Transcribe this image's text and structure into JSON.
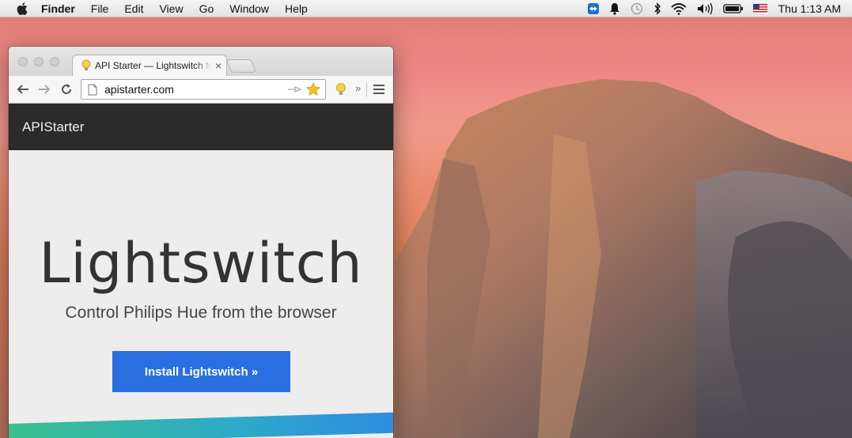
{
  "menubar": {
    "app_name": "Finder",
    "menus": [
      "File",
      "Edit",
      "View",
      "Go",
      "Window",
      "Help"
    ],
    "clock": "Thu 1:13 AM",
    "tray_icons": [
      "teamviewer-icon",
      "notification-bell-icon",
      "time-machine-icon",
      "bluetooth-icon",
      "wifi-icon",
      "volume-icon",
      "battery-icon",
      "us-flag-input-icon"
    ]
  },
  "browser": {
    "tab_title": "API Starter — Lightswitch for Philips Hue",
    "tab_close": "×",
    "url": "apistarter.com",
    "overflow_chevron": "»"
  },
  "site": {
    "brand": "APIStarter",
    "hero_title": "Lightswitch",
    "hero_subtitle": "Control Philips Hue from the browser",
    "cta_label": "Install Lightswitch »"
  },
  "colors": {
    "cta": "#2a6fe0",
    "header": "#2b2b2b",
    "stripe_start": "#39c08c",
    "stripe_end": "#2c8de0"
  }
}
